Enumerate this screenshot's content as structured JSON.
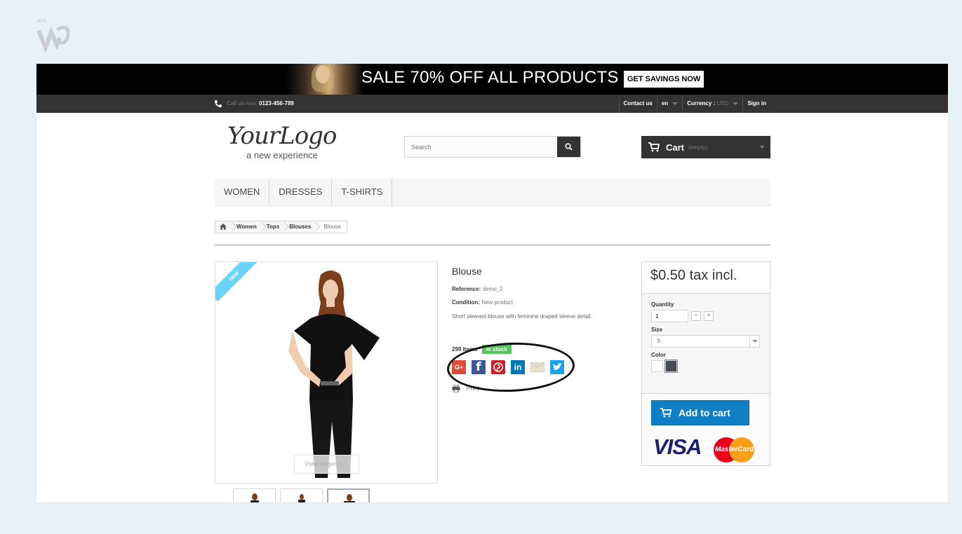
{
  "banner": {
    "text": "SALE 70% OFF ALL PRODUCTS",
    "button": "GET SAVINGS NOW"
  },
  "topbar": {
    "call_label": "Call us now:",
    "phone": "0123-456-789",
    "contact": "Contact us",
    "language": "en",
    "currency_label": "Currency :",
    "currency_value": "USD",
    "signin": "Sign in"
  },
  "logo": {
    "text": "YourLogo",
    "tagline": "a new experience"
  },
  "search": {
    "placeholder": "Search"
  },
  "cart": {
    "label": "Cart",
    "status": "(empty)"
  },
  "menu": [
    "WOMEN",
    "DRESSES",
    "T-SHIRTS"
  ],
  "breadcrumb": [
    "Women",
    "Tops",
    "Blouses",
    "Blouse"
  ],
  "image": {
    "ribbon": "NEW",
    "view_larger": "View larger"
  },
  "product": {
    "name": "Blouse",
    "reference_label": "Reference:",
    "reference_value": "demo_2",
    "condition_label": "Condition:",
    "condition_value": "New product",
    "description": "Short sleeved blouse with feminine draped sleeve detail.",
    "items": "299 Items",
    "stock": "In stock",
    "print": "Print"
  },
  "social": [
    {
      "name": "google-plus",
      "glyph": "G+",
      "color": "#dd4b39"
    },
    {
      "name": "facebook",
      "glyph": "f",
      "color": "#3b5998"
    },
    {
      "name": "pinterest",
      "glyph": "P",
      "color": "#cb2027"
    },
    {
      "name": "linkedin",
      "glyph": "in",
      "color": "#0077b5"
    },
    {
      "name": "email",
      "glyph": "",
      "color": "#e8e0cc"
    },
    {
      "name": "twitter",
      "glyph": "t",
      "color": "#1da1f2"
    }
  ],
  "buybox": {
    "price": "$0.50 tax incl.",
    "quantity_label": "Quantity",
    "quantity_value": "1",
    "size_label": "Size",
    "size_value": "S",
    "color_label": "Color",
    "colors": [
      "#ffffff",
      "#434a54"
    ],
    "add_to_cart": "Add to cart"
  },
  "payment": {
    "visa": "VISA",
    "mastercard": "MasterCard"
  }
}
